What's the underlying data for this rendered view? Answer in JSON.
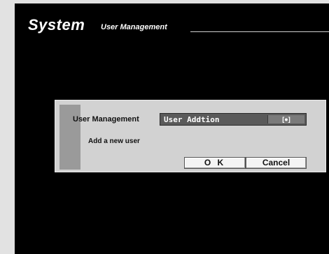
{
  "header": {
    "title": "System",
    "subtitle": "User Management"
  },
  "dialog": {
    "title": "User Management",
    "dropdown_value": "User Addtion",
    "dropdown_button": "[●]",
    "description": "Add a new user",
    "ok_label": "O K",
    "cancel_label": "Cancel"
  },
  "colors": {
    "screen_bg": "#000000",
    "dialog_bg": "#d2d2d2",
    "dropdown_bg": "#5a5a5a"
  }
}
